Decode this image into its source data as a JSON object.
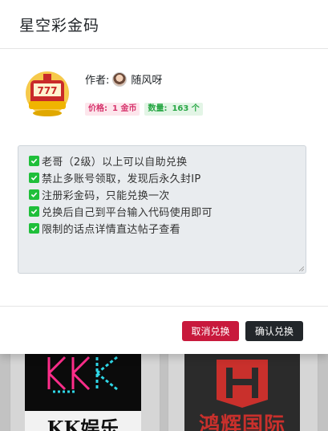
{
  "modal": {
    "title": "星空彩金码",
    "author_label": "作者:",
    "author_name": "随风呀",
    "price_label": "价格:",
    "price_value": "1 金币",
    "qty_label": "数量:",
    "qty_value": "163 个",
    "description_lines": [
      "老哥（2级）以上可以自助兑换",
      "禁止多账号领取，发现后永久封IP",
      "注册彩金码，只能兑换一次",
      "兑换后自己到平台输入代码使用即可",
      "限制的话点详情直达帖子查看"
    ],
    "cancel_label": "取消兑换",
    "confirm_label": "确认兑换"
  },
  "background": {
    "card1_text": "KK娱乐",
    "card2_text": "鸿辉国际"
  },
  "colors": {
    "cancel": "#c8193c",
    "confirm": "#22262a",
    "price_text": "#d6336c",
    "qty_text": "#28a745",
    "check": "#1fbf3a"
  }
}
